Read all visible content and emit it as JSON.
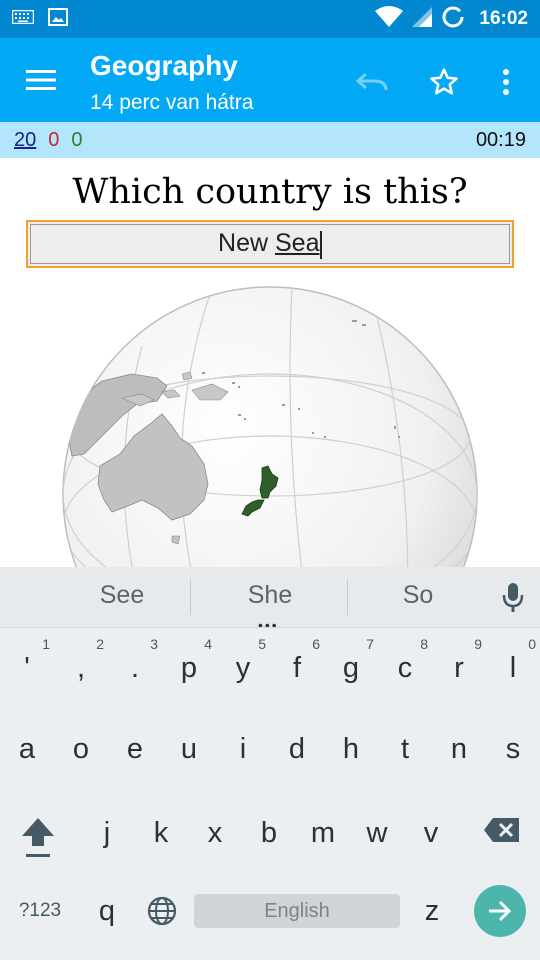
{
  "status_bar": {
    "time": "16:02",
    "icons": [
      "keyboard-icon",
      "image-icon",
      "wifi-icon",
      "signal-icon",
      "sync-icon"
    ]
  },
  "app_bar": {
    "title": "Geography",
    "subtitle": "14 perc van hátra",
    "icons": [
      "menu-icon",
      "undo-icon",
      "star-icon",
      "more-vert-icon"
    ]
  },
  "score": {
    "total": "20",
    "wrong": "0",
    "right": "0",
    "timer": "00:19"
  },
  "quiz": {
    "question": "Which country is this?",
    "answer_prefix": "New ",
    "answer_composing": "Sea"
  },
  "keyboard": {
    "suggestions": [
      "See",
      "She",
      "So"
    ],
    "row1": [
      {
        "ch": "'",
        "hint": "1"
      },
      {
        "ch": ",",
        "hint": "2"
      },
      {
        "ch": ".",
        "hint": "3"
      },
      {
        "ch": "p",
        "hint": "4"
      },
      {
        "ch": "y",
        "hint": "5"
      },
      {
        "ch": "f",
        "hint": "6"
      },
      {
        "ch": "g",
        "hint": "7"
      },
      {
        "ch": "c",
        "hint": "8"
      },
      {
        "ch": "r",
        "hint": "9"
      },
      {
        "ch": "l",
        "hint": "0"
      }
    ],
    "row2": [
      "a",
      "o",
      "e",
      "u",
      "i",
      "d",
      "h",
      "t",
      "n",
      "s"
    ],
    "row3": [
      "j",
      "k",
      "x",
      "b",
      "m",
      "w",
      "v"
    ],
    "row4": {
      "symbols": "?123",
      "q": "q",
      "space": "English",
      "z": "z"
    }
  },
  "colors": {
    "status_bar": "#0288d1",
    "app_bar": "#03a9f4",
    "score_bar": "#b3e5fc",
    "answer_border": "#f0a030",
    "highlight_country": "#2e5e2a",
    "enter_key": "#4db6ac"
  }
}
